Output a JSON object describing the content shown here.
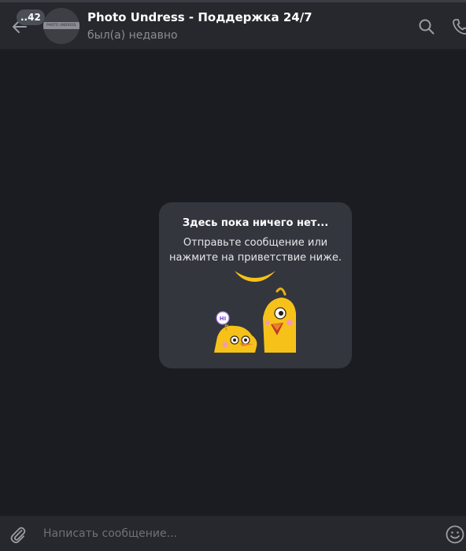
{
  "header": {
    "unread_count": "..42",
    "avatar_text": "PHOTO UNDRESS",
    "title": "Photo Undress - Поддержка 24/7",
    "status": "был(а) недавно"
  },
  "empty_state": {
    "title": "Здесь пока ничего нет...",
    "description": "Отправьте сообщение или нажмите на приветствие ниже.",
    "sticker_bubble_text": "HI"
  },
  "composer": {
    "placeholder": "Написать сообщение..."
  },
  "colors": {
    "background": "#1b1c21",
    "header": "#26282e",
    "card": "#33363d",
    "sticker_yellow": "#f6c21a"
  }
}
